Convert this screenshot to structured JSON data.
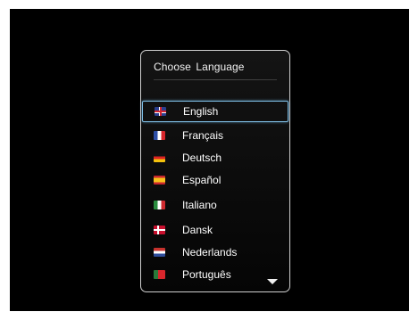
{
  "dialog": {
    "title": "Choose  Language"
  },
  "languages": [
    {
      "label": "English",
      "flag": "uk-flag-icon",
      "selected": true
    },
    {
      "label": "Français",
      "flag": "france-flag-icon",
      "selected": false
    },
    {
      "label": "Deutsch",
      "flag": "germany-flag-icon",
      "selected": false
    },
    {
      "label": "Español",
      "flag": "spain-flag-icon",
      "selected": false
    },
    {
      "label": "Italiano",
      "flag": "italy-flag-icon",
      "selected": false
    },
    {
      "label": "Dansk",
      "flag": "denmark-flag-icon",
      "selected": false
    },
    {
      "label": "Nederlands",
      "flag": "netherlands-flag-icon",
      "selected": false
    },
    {
      "label": "Português",
      "flag": "portugal-flag-icon",
      "selected": false
    }
  ],
  "scroll": {
    "icon": "scroll-down-arrow-icon"
  },
  "colors": {
    "background": "#000000",
    "selection_border": "#7fc0e8",
    "dialog_border": "#cfcfcf",
    "text": "#ffffff"
  }
}
